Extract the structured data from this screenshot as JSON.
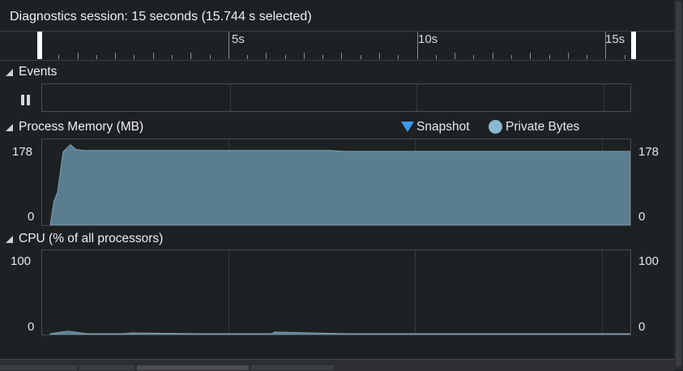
{
  "session": {
    "title": "Diagnostics session: 15 seconds (15.744 s selected)"
  },
  "timeline": {
    "tick_labels": [
      "5s",
      "10s",
      "15s"
    ],
    "duration_seconds": 15.744
  },
  "events": {
    "title": "Events",
    "pause_icon": "pause-icon"
  },
  "memory": {
    "title": "Process Memory (MB)",
    "legend_snapshot": "Snapshot",
    "legend_private_bytes": "Private Bytes",
    "y_max_label": "178",
    "y_min_label": "0",
    "color_area": "#5a7d8f",
    "color_snapshot": "#3b9be8",
    "color_private_bytes": "#8ab8cf"
  },
  "cpu": {
    "title": "CPU (% of all processors)",
    "y_max_label": "100",
    "y_min_label": "0"
  },
  "chart_data": [
    {
      "type": "area",
      "title": "Process Memory (MB)",
      "ylim": [
        0,
        178
      ],
      "series": [
        {
          "name": "Private Bytes",
          "x": [
            0.0,
            0.1,
            0.2,
            0.35,
            0.55,
            0.7,
            0.9,
            1.2,
            3.0,
            5.0,
            7.6,
            8.0,
            10.0,
            12.0,
            14.0,
            15.744
          ],
          "values": [
            0,
            50,
            70,
            155,
            170,
            160,
            158,
            158,
            158,
            158,
            158,
            156,
            156,
            156,
            156,
            156
          ]
        }
      ]
    },
    {
      "type": "area",
      "title": "CPU (% of all processors)",
      "ylim": [
        0,
        100
      ],
      "series": [
        {
          "x": [
            0.0,
            0.3,
            0.5,
            1.0,
            2.0,
            2.2,
            4.0,
            6.0,
            6.1,
            8.0,
            10.0,
            12.0,
            14.0,
            15.744
          ],
          "values": [
            1,
            3,
            4,
            1,
            1,
            2,
            1,
            1,
            3,
            1,
            1,
            1,
            1,
            1
          ]
        }
      ]
    }
  ]
}
